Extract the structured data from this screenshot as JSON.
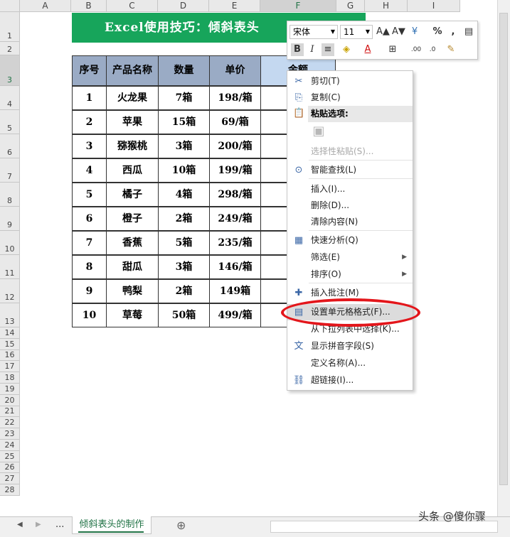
{
  "grid": {
    "columns": [
      "A",
      "B",
      "C",
      "D",
      "E",
      "F",
      "G",
      "H",
      "I"
    ],
    "rows": [
      "1",
      "2",
      "3",
      "4",
      "5",
      "6",
      "7",
      "8",
      "9",
      "10",
      "11",
      "12",
      "13",
      "14",
      "15",
      "16",
      "17",
      "18",
      "19",
      "20",
      "21",
      "22",
      "23",
      "24",
      "25",
      "26",
      "27",
      "28"
    ]
  },
  "banner": {
    "title": "Excel使用技巧：倾斜表头"
  },
  "table": {
    "headers": [
      "序号",
      "产品名称",
      "数量",
      "单价",
      "金额"
    ],
    "rows": [
      [
        "1",
        "火龙果",
        "7箱",
        "198/箱"
      ],
      [
        "2",
        "苹果",
        "15箱",
        "69/箱"
      ],
      [
        "3",
        "猕猴桃",
        "3箱",
        "200/箱"
      ],
      [
        "4",
        "西瓜",
        "10箱",
        "199/箱"
      ],
      [
        "5",
        "橘子",
        "4箱",
        "298/箱"
      ],
      [
        "6",
        "橙子",
        "2箱",
        "249/箱"
      ],
      [
        "7",
        "香蕉",
        "5箱",
        "235/箱"
      ],
      [
        "8",
        "甜瓜",
        "3箱",
        "146/箱"
      ],
      [
        "9",
        "鸭梨",
        "2箱",
        "149箱"
      ],
      [
        "10",
        "草莓",
        "50箱",
        "499/箱"
      ]
    ]
  },
  "mini_toolbar": {
    "font_name": "宋体",
    "font_size": "11",
    "buttons_row1": [
      "A▲",
      "A▼",
      "¥",
      "%",
      ","
    ],
    "buttons_row2": [
      "B",
      "I",
      "≡",
      "A"
    ]
  },
  "context_menu": {
    "items": [
      {
        "label": "剪切(T)",
        "icon": "scissors-icon"
      },
      {
        "label": "复制(C)",
        "icon": "copy-icon"
      },
      {
        "label": "粘贴选项:",
        "icon": "paste-icon",
        "section": true
      },
      {
        "label": "",
        "icon": "clipboard-icon"
      },
      {
        "label": "选择性粘贴(S)...",
        "disabled": true
      },
      {
        "label": "智能查找(L)",
        "icon": "smart-lookup-icon"
      },
      {
        "label": "插入(I)..."
      },
      {
        "label": "删除(D)..."
      },
      {
        "label": "清除内容(N)"
      },
      {
        "label": "快速分析(Q)",
        "icon": "quick-analysis-icon"
      },
      {
        "label": "筛选(E)",
        "submenu": true
      },
      {
        "label": "排序(O)",
        "submenu": true
      },
      {
        "label": "插入批注(M)",
        "icon": "comment-icon"
      },
      {
        "label": "设置单元格格式(F)...",
        "icon": "format-cells-icon",
        "highlighted": true
      },
      {
        "label": "从下拉列表中选择(K)..."
      },
      {
        "label": "显示拼音字段(S)",
        "icon": "phonetic-icon"
      },
      {
        "label": "定义名称(A)..."
      },
      {
        "label": "超链接(I)...",
        "icon": "hyperlink-icon"
      }
    ]
  },
  "sheet_tab": {
    "label": "倾斜表头的制作",
    "more": "...",
    "add": "⊕"
  },
  "watermark": "头条 @傻你骤",
  "colors": {
    "accent": "#217346",
    "banner": "#17a55b",
    "header_fill": "#9aabc5",
    "highlight_ring": "#e3161b"
  }
}
